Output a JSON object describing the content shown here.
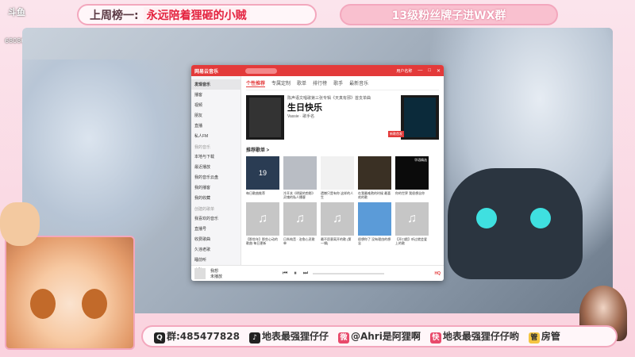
{
  "overlay": {
    "top_label": "上周榜一:",
    "top_name": "永远陪着狸砸的小贼",
    "top_right": "13级粉丝牌子进WX群",
    "logo": "斗鱼",
    "room_id": "6808050",
    "bottom": {
      "qq": "群:485477828",
      "douyin": "地表最强狸仔仔",
      "weibo": "@Ahri是阿狸啊",
      "kuaishou": "地表最强狸仔仔哟",
      "mgr": "房管"
    }
  },
  "app": {
    "brand": "网易云音乐",
    "user": "用户名称",
    "title_controls": [
      "—",
      "□",
      "✕"
    ],
    "sidebar": {
      "items": [
        "发现音乐",
        "播客",
        "视频",
        "朋友",
        "直播",
        "私人FM"
      ],
      "section_mine": "我的音乐",
      "mine_items": [
        "本地与下载",
        "最近播放",
        "我的音乐云盘",
        "我的播客",
        "我的收藏"
      ],
      "section_created": "创建的歌单",
      "created_items": [
        "我喜欢的音乐",
        "直播号",
        "收费歌曲",
        "久违老歌",
        "睡前听",
        "奔驰"
      ]
    },
    "tabs": [
      "个性推荐",
      "专属定制",
      "歌单",
      "排行榜",
      "歌手",
      "最新音乐"
    ],
    "banner": {
      "header": "陈声语文唱歌第三张专辑《天真有邪》首支单曲",
      "title": "生日快乐",
      "artist": "Vassie · 歌手名",
      "tag": "新歌首发"
    },
    "section_title": "推荐歌单 >",
    "playlists": [
      {
        "caption": "每日歌曲推荐",
        "thumb": "19"
      },
      {
        "caption": "冷开关《明星的剪影》灵魂的私人播客",
        "thumb": ""
      },
      {
        "caption": "遗憾只是有你 这样的人生",
        "thumb": ""
      },
      {
        "caption": "在我最难熬的时候 最喜欢的歌",
        "thumb": ""
      },
      {
        "caption": "你的世界 我很想念你",
        "thumb": "华语精选"
      },
      {
        "caption": "【那些年】那些心动的歌曲·每日更新",
        "thumb": ""
      },
      {
        "caption": "日系纯音 · 治愈心灵歌单",
        "thumb": ""
      },
      {
        "caption": "最不愿意离开的歌 (第一辑)",
        "thumb": ""
      },
      {
        "caption": "很想你了 没有理由的想念",
        "thumb": ""
      },
      {
        "caption": "【开口跪】听过就会爱上的歌",
        "thumb": ""
      }
    ],
    "player": {
      "song": "我想",
      "artist": "未播放",
      "quality": "HQ"
    }
  }
}
